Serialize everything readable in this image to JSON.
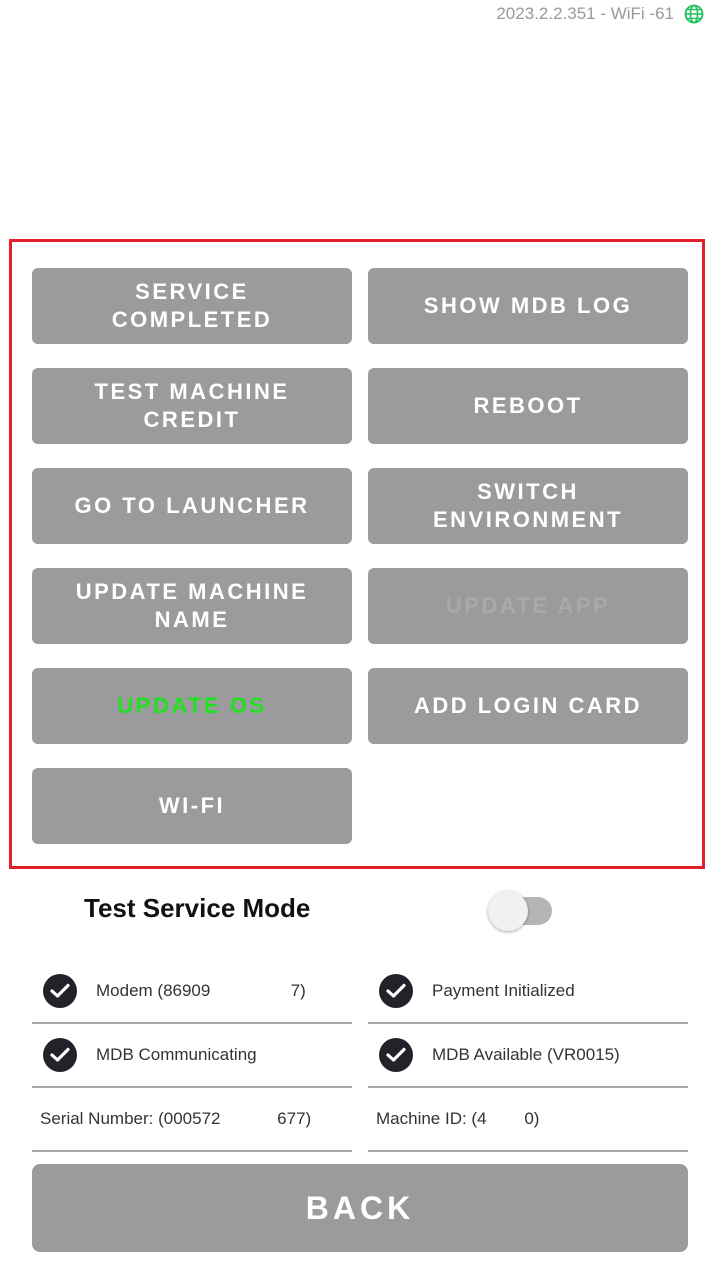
{
  "status_bar": {
    "version_text": "2023.2.2.351 - WiFi -61",
    "network_icon": "globe-icon",
    "network_icon_color": "#1ec05a"
  },
  "panel_border_color": "#e31e2d",
  "buttons": {
    "service_completed": "SERVICE\nCOMPLETED",
    "show_mdb_log": "SHOW MDB LOG",
    "test_machine_credit": "TEST MACHINE\nCREDIT",
    "reboot": "REBOOT",
    "go_to_launcher": "GO TO LAUNCHER",
    "switch_environment": "SWITCH\nENVIRONMENT",
    "update_machine_name": "UPDATE MACHINE\nNAME",
    "update_app": "UPDATE APP",
    "update_os": "UPDATE OS",
    "add_login_card": "ADD LOGIN CARD",
    "wifi": "WI-FI"
  },
  "button_colors": {
    "background": "#9b9b9e",
    "text": "#ffffff",
    "disabled_text": "#a9a9ab",
    "update_os_text": "#1ee21e"
  },
  "test_service_mode": {
    "label": "Test Service Mode",
    "enabled": false
  },
  "status_items": {
    "modem": "Modem (86909                 7)",
    "payment": "Payment Initialized",
    "mdb_comm": "MDB Communicating",
    "mdb_available": "MDB Available (VR0015)",
    "serial_number": "Serial Number: (000572            677)",
    "machine_id": "Machine ID: (4        0)"
  },
  "back_button": "BACK"
}
